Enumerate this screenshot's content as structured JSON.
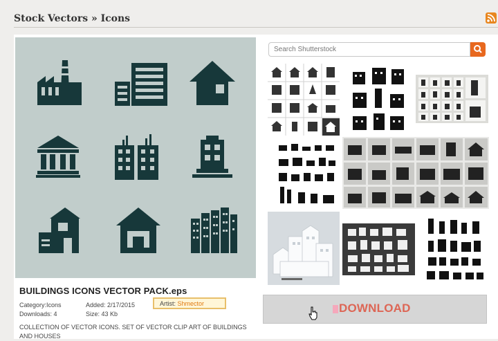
{
  "header": {
    "breadcrumb": "Stock Vectors » Icons",
    "icon": "rss-icon"
  },
  "preview": {
    "icons": [
      "factory-icon",
      "office-building-icon",
      "house-icon",
      "bank-icon",
      "twin-towers-icon",
      "tower-icon",
      "two-story-house-icon",
      "home-icon",
      "city-skyline-icon"
    ]
  },
  "item": {
    "title": "BUILDINGS ICONS VECTOR PACK.eps",
    "category": "Category:Icons",
    "downloads": "Downloads: 4",
    "added": "Added: 2/17/2015",
    "size": "Size: 43 Kb",
    "artist_label": "Artist:",
    "artist_name": "Shmector",
    "description": "COLLECTION OF VECTOR ICONS. SET OF VECTOR CLIP ART OF BUILDINGS AND HOUSES"
  },
  "search": {
    "placeholder": "Search Shutterstock",
    "button_icon": "search-icon"
  },
  "thumbnails": [
    "building-icons-grid",
    "city-buildings-set",
    "buildings-on-tiles",
    "mixed-buildings-set",
    "gray-tile-buildings",
    "paper-city-3d",
    "dark-panel-buildings",
    "skyscrapers-set"
  ],
  "download": {
    "label": "DOWNLOAD",
    "cursor": "hand-pointer-icon"
  },
  "colors": {
    "accent": "#e8681e",
    "preview_bg": "#c1cdcb",
    "icon_dark": "#17383a",
    "download_text": "#dd6655"
  }
}
